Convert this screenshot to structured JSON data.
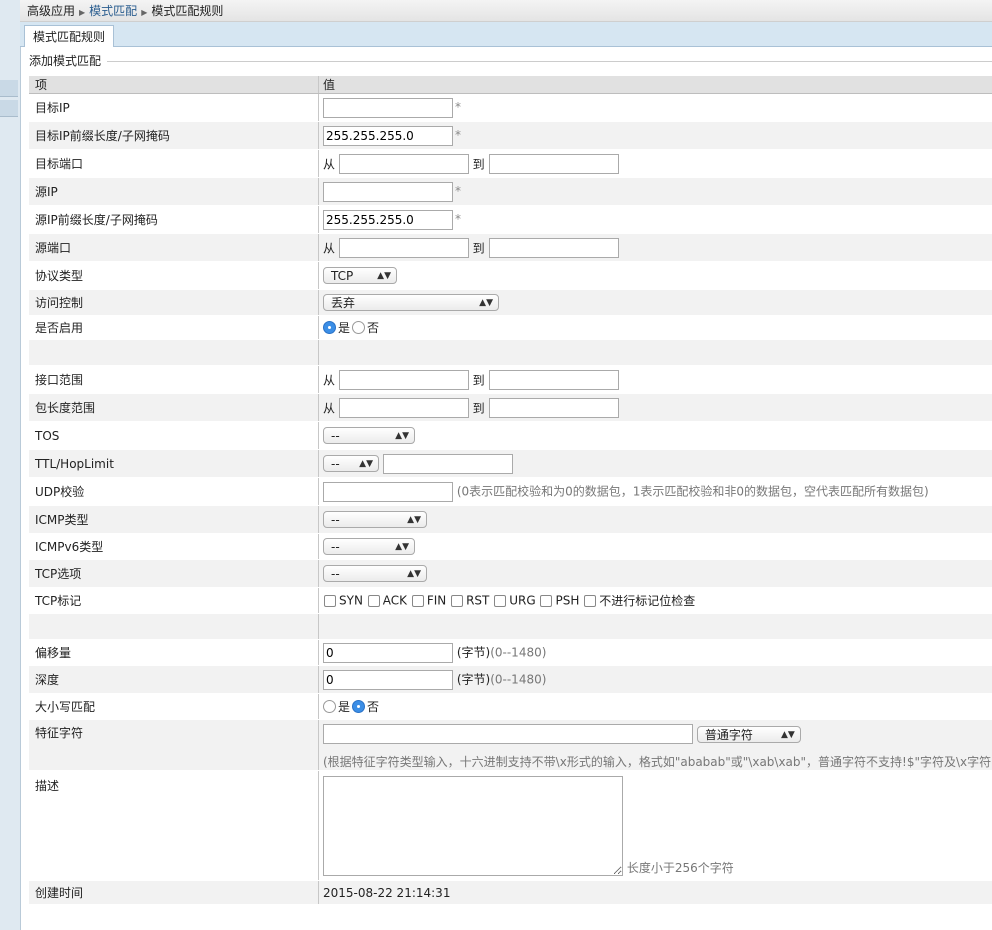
{
  "breadcrumb": {
    "items": [
      "高级应用",
      "模式匹配",
      "模式匹配规则"
    ]
  },
  "tabs": [
    {
      "label": "模式匹配规则"
    }
  ],
  "section_title": "添加模式匹配",
  "table": {
    "col_key": "项",
    "col_value": "值"
  },
  "fields": {
    "target_ip": {
      "label": "目标IP",
      "value": ""
    },
    "target_mask": {
      "label": "目标IP前缀长度/子网掩码",
      "value": "255.255.255.0"
    },
    "target_port": {
      "label": "目标端口",
      "from": "从",
      "to": "到",
      "from_value": "",
      "to_value": ""
    },
    "source_ip": {
      "label": "源IP",
      "value": ""
    },
    "source_mask": {
      "label": "源IP前缀长度/子网掩码",
      "value": "255.255.255.0"
    },
    "source_port": {
      "label": "源端口",
      "from": "从",
      "to": "到",
      "from_value": "",
      "to_value": ""
    },
    "protocol": {
      "label": "协议类型",
      "value": "TCP"
    },
    "access": {
      "label": "访问控制",
      "value": "丢弃"
    },
    "enabled": {
      "label": "是否启用",
      "yes": "是",
      "no": "否",
      "selected": "yes"
    },
    "iface_range": {
      "label": "接口范围",
      "from": "从",
      "to": "到"
    },
    "pkt_len": {
      "label": "包长度范围",
      "from": "从",
      "to": "到"
    },
    "tos": {
      "label": "TOS",
      "value": "--"
    },
    "ttl": {
      "label": "TTL/HopLimit",
      "value": "--",
      "input": ""
    },
    "udp_check": {
      "label": "UDP校验",
      "value": "",
      "hint": "(0表示匹配校验和为0的数据包，1表示匹配校验和非0的数据包，空代表匹配所有数据包)"
    },
    "icmp_type": {
      "label": "ICMP类型",
      "value": "--"
    },
    "icmpv6_type": {
      "label": "ICMPv6类型",
      "value": "--"
    },
    "tcp_option": {
      "label": "TCP选项",
      "value": "--"
    },
    "tcp_flags": {
      "label": "TCP标记",
      "flags": [
        "SYN",
        "ACK",
        "FIN",
        "RST",
        "URG",
        "PSH",
        "不进行标记位检查"
      ]
    },
    "offset": {
      "label": "偏移量",
      "value": "0",
      "unit": "(字节)",
      "range": "(0--1480)"
    },
    "depth": {
      "label": "深度",
      "value": "0",
      "unit": "(字节)",
      "range": "(0--1480)"
    },
    "case_match": {
      "label": "大小写匹配",
      "yes": "是",
      "no": "否",
      "selected": "no"
    },
    "signature": {
      "label": "特征字符",
      "value": "",
      "type": "普通字符",
      "hint": "(根据特征字符类型输入，十六进制支持不带\\x形式的输入，格式如\"ababab\"或\"\\xab\\xab\"，普通字符不支持!$\"字符及\\x字符)"
    },
    "description": {
      "label": "描述",
      "value": "",
      "hint": "长度小于256个字符"
    },
    "created": {
      "label": "创建时间",
      "value": "2015-08-22 21:14:31"
    }
  }
}
